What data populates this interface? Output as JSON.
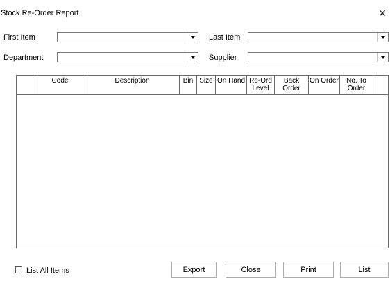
{
  "window": {
    "title": "Stock Re-Order Report",
    "close_glyph": "✕"
  },
  "filters": {
    "first_item": {
      "label": "First Item",
      "value": ""
    },
    "last_item": {
      "label": "Last Item",
      "value": ""
    },
    "department": {
      "label": "Department",
      "value": ""
    },
    "supplier": {
      "label": "Supplier",
      "value": ""
    }
  },
  "grid": {
    "columns": [
      "",
      "Code",
      "Description",
      "Bin",
      "Size",
      "On Hand",
      "Re-Ord\nLevel",
      "Back\nOrder",
      "On Order",
      "No. To\nOrder",
      ""
    ],
    "rows": []
  },
  "footer": {
    "list_all_items": {
      "label": "List All Items",
      "checked": false
    },
    "buttons": {
      "export": "Export",
      "close": "Close",
      "print": "Print",
      "list": "List"
    }
  }
}
